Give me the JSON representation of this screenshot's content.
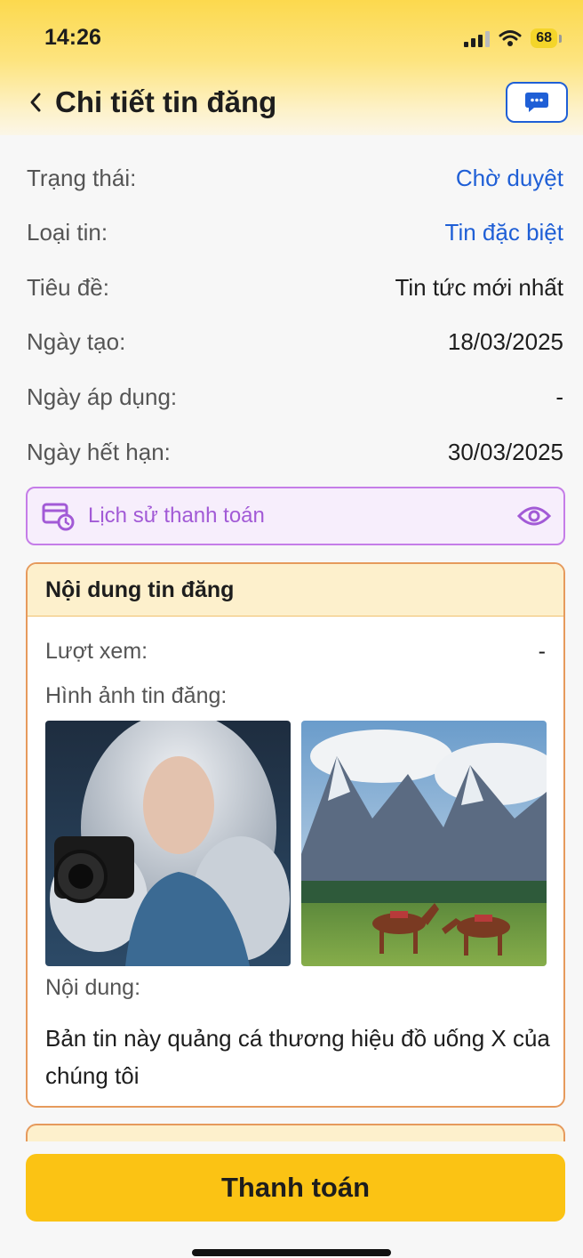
{
  "status_bar": {
    "time": "14:26",
    "battery": "68"
  },
  "header": {
    "title": "Chi tiết tin đăng"
  },
  "details": [
    {
      "label": "Trạng thái:",
      "value": "Chờ duyệt"
    },
    {
      "label": "Loại tin:",
      "value": "Tin đặc biệt"
    },
    {
      "label": "Tiêu đề:",
      "value": "Tin tức mới nhất"
    },
    {
      "label": "Ngày tạo:",
      "value": "18/03/2025"
    },
    {
      "label": "Ngày áp dụng:",
      "value": "-"
    },
    {
      "label": "Ngày hết hạn:",
      "value": "30/03/2025"
    }
  ],
  "payment_history": {
    "label": "Lịch sử thanh toán"
  },
  "content_card": {
    "title": "Nội dung tin đăng",
    "views_label": "Lượt xem:",
    "views_value": "-",
    "images_label": "Hình ảnh tin đăng:",
    "content_label": "Nội dung:",
    "content_text": "Bản tin này quảng cá thương hiệu đồ uống X của chúng tôi"
  },
  "pay_button": {
    "label": "Thanh toán"
  },
  "colors": {
    "accent": "#fbc314",
    "link": "#1f5fd6",
    "purple": "#a25ad6",
    "card_border": "#e69a5c"
  }
}
